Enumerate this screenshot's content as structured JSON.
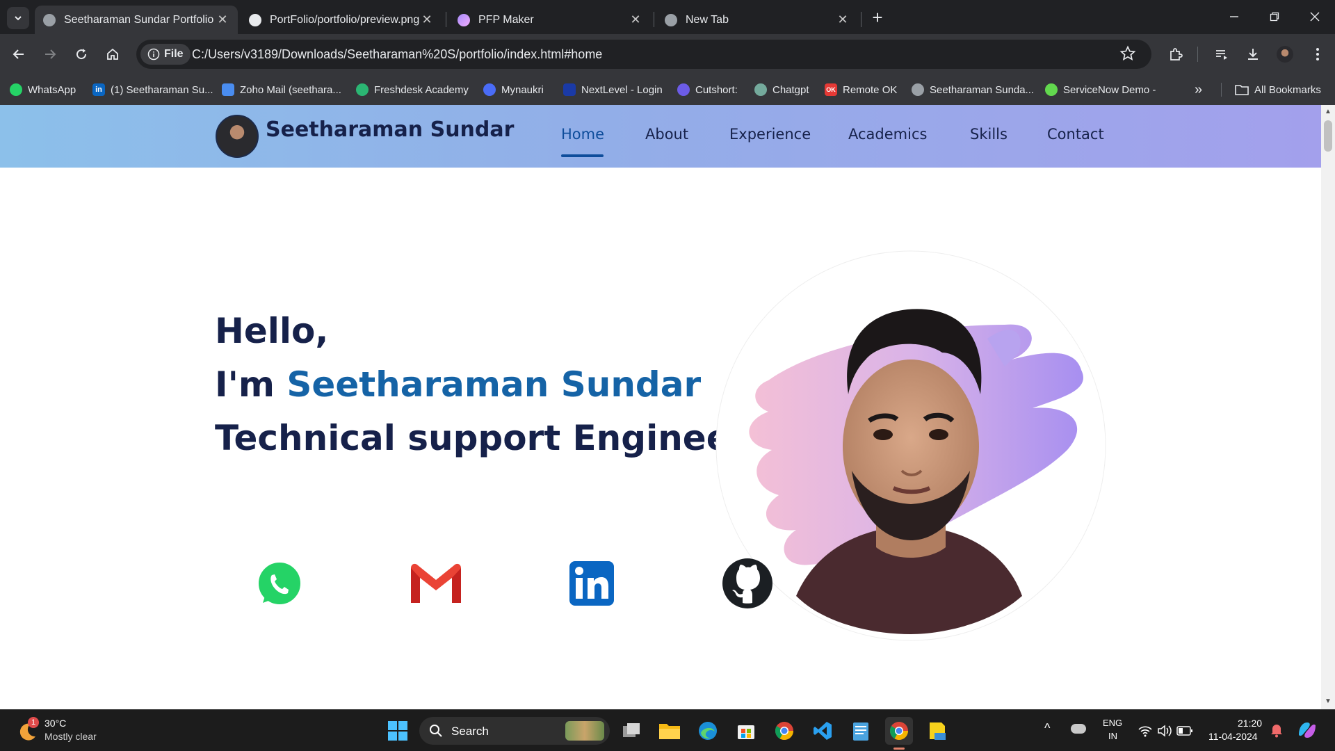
{
  "browser": {
    "tabs": [
      {
        "title": "Seetharaman Sundar Portfolio",
        "active": true
      },
      {
        "title": "PortFolio/portfolio/preview.png",
        "active": false
      },
      {
        "title": "PFP Maker",
        "active": false
      },
      {
        "title": "New Tab",
        "active": false
      }
    ],
    "new_tab_symbol": "+",
    "window_controls": [
      "minimize",
      "restore",
      "close"
    ],
    "address": {
      "chip": "File",
      "url": "C:/Users/v3189/Downloads/Seetharaman%20S/portfolio/index.html#home"
    },
    "bookmarks": [
      {
        "label": "WhatsApp",
        "icon": "whatsapp-icon",
        "color": "#25d366"
      },
      {
        "label": "(1) Seetharaman Su...",
        "icon": "linkedin-icon",
        "color": "#0a66c2"
      },
      {
        "label": "Zoho Mail (seethara...",
        "icon": "zoho-mail-icon",
        "color": "#4a8df0"
      },
      {
        "label": "Freshdesk Academy",
        "icon": "freshdesk-icon",
        "color": "#2bb673"
      },
      {
        "label": "Mynaukri",
        "icon": "naukri-icon",
        "color": "#4a6cf7"
      },
      {
        "label": "NextLevel - Login",
        "icon": "nextlevel-icon",
        "color": "#1a3aa6"
      },
      {
        "label": "Cutshort:",
        "icon": "cutshort-icon",
        "color": "#6c5ce7"
      },
      {
        "label": "Chatgpt",
        "icon": "chatgpt-icon",
        "color": "#74aa9c"
      },
      {
        "label": "Remote OK",
        "icon": "remote-ok-icon",
        "color": "#e53935"
      },
      {
        "label": "Seetharaman Sunda...",
        "icon": "globe-icon",
        "color": "#9aa0a6"
      },
      {
        "label": "ServiceNow Demo -",
        "icon": "servicenow-icon",
        "color": "#62d84e"
      }
    ],
    "all_bookmarks_label": "All Bookmarks"
  },
  "page": {
    "brand_name": "Seetharaman Sundar",
    "nav": [
      "Home",
      "About",
      "Experience",
      "Academics",
      "Skills",
      "Contact"
    ],
    "active_nav": "Home",
    "hero": {
      "greeting": "Hello,",
      "prefix": "I'm ",
      "name": "Seetharaman Sundar",
      "role": "Technical support Engineer"
    },
    "socials": [
      "whatsapp-icon",
      "gmail-icon",
      "linkedin-icon",
      "github-icon"
    ],
    "colors": {
      "heading": "#16214a",
      "accent": "#1563a6"
    }
  },
  "taskbar": {
    "weather": {
      "temp": "30°C",
      "condition": "Mostly clear",
      "badge": "1"
    },
    "search_label": "Search",
    "language": {
      "line1": "ENG",
      "line2": "IN"
    },
    "clock": {
      "time": "21:20",
      "date": "11-04-2024"
    }
  }
}
